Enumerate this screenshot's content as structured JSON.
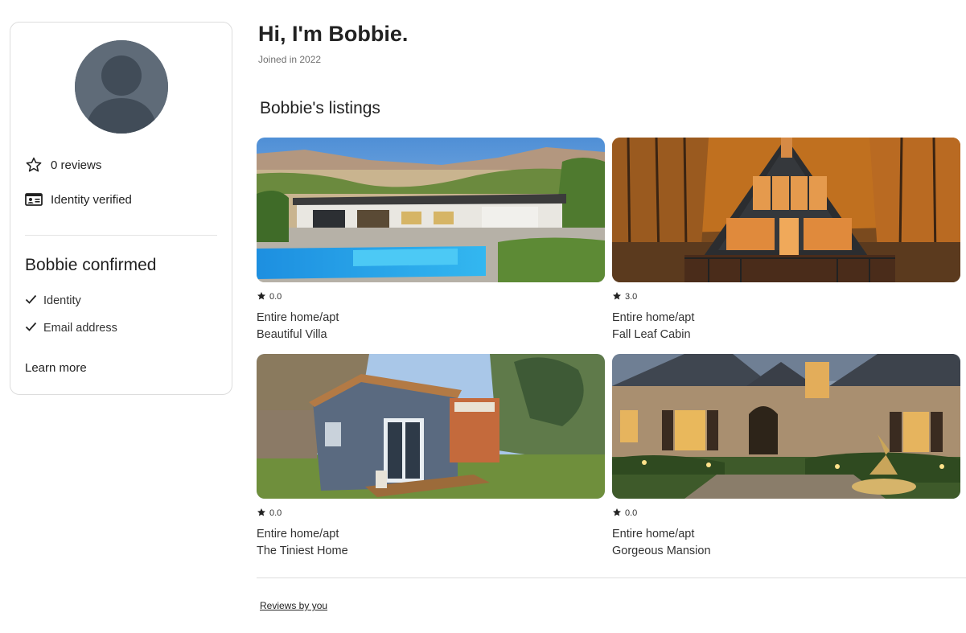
{
  "profile": {
    "reviews_count": "0 reviews",
    "identity_status": "Identity verified",
    "confirmed_title": "Bobbie confirmed",
    "confirmed_items": [
      "Identity",
      "Email address"
    ],
    "learn_more": "Learn more"
  },
  "header": {
    "title": "Hi, I'm Bobbie.",
    "joined": "Joined in 2022"
  },
  "listings": {
    "title": "Bobbie's listings",
    "items": [
      {
        "rating": "0.0",
        "type": "Entire home/apt",
        "name": "Beautiful Villa"
      },
      {
        "rating": "3.0",
        "type": "Entire home/apt",
        "name": "Fall Leaf Cabin"
      },
      {
        "rating": "0.0",
        "type": "Entire home/apt",
        "name": "The Tiniest Home"
      },
      {
        "rating": "0.0",
        "type": "Entire home/apt",
        "name": "Gorgeous Mansion"
      }
    ]
  },
  "footer": {
    "reviews_link": "Reviews by you"
  }
}
